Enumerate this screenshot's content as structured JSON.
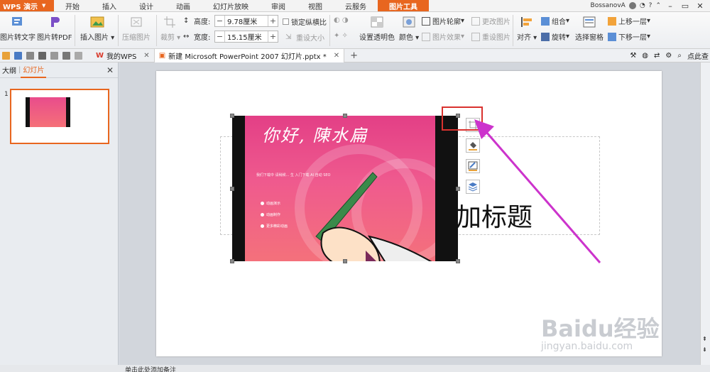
{
  "app": {
    "logo": "WPS 演示"
  },
  "menu_tabs": [
    "开始",
    "插入",
    "设计",
    "动画",
    "幻灯片放映",
    "审阅",
    "视图",
    "云服务",
    "图片工具"
  ],
  "active_menu_tab": "图片工具",
  "user": {
    "name": "BossanovA"
  },
  "ribbon": {
    "pic_to_text": "图片转文字",
    "pic_to_pdf": "图片转PDF",
    "insert_picture": "插入图片",
    "compress_picture": "压缩图片",
    "crop": "裁剪",
    "height_label": "高度:",
    "height_value": "9.78厘米",
    "width_label": "宽度:",
    "width_value": "15.15厘米",
    "lock_ratio": "锁定纵横比",
    "reset_size": "重设大小",
    "set_transparent": "设置透明色",
    "color": "颜色",
    "picture_outline": "图片轮廓",
    "picture_effect": "图片效果",
    "change_picture": "更改图片",
    "reset_picture": "重设图片",
    "align": "对齐",
    "group": "组合",
    "rotate": "旋转",
    "selection_pane": "选择窗格",
    "bring_forward": "上移一层",
    "send_backward": "下移一层"
  },
  "doc_tabs": [
    {
      "label": "我的WPS"
    },
    {
      "label": "新建 Microsoft PowerPoint 2007 幻灯片.pptx *"
    }
  ],
  "qbar_right": {
    "search_label": "点此查"
  },
  "panel": {
    "tab_outline": "大纲",
    "tab_slides": "幻灯片",
    "slide_number": "1"
  },
  "slide": {
    "title_placeholder": "加标题",
    "picture": {
      "title": "你好, 陳水扁",
      "subtitle": "我们下载中  请稍候... 生 入门下载 AI 自动 SEO",
      "bullets": [
        "动画演示",
        "动画制作",
        "更多精彩动画"
      ]
    }
  },
  "status": {
    "notes_placeholder": "单击此处添加备注"
  },
  "watermark": {
    "brand": "Baidu经验",
    "url": "jingyan.baidu.com"
  },
  "colors": {
    "accent": "#e8661f",
    "highlight_box": "#d9322e",
    "arrow": "#cc33cc"
  }
}
